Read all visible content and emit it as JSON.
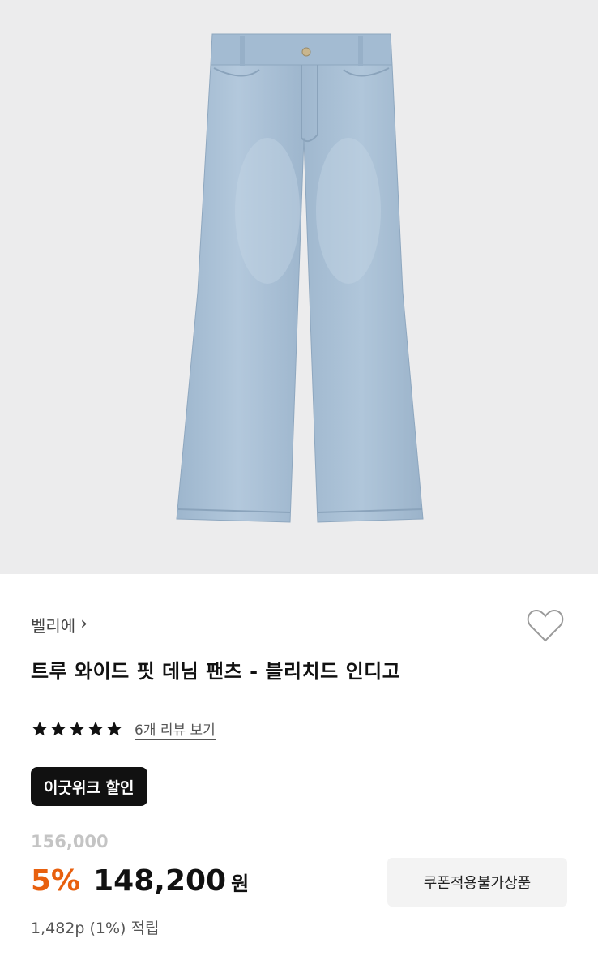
{
  "product": {
    "image_alt": "light blue wide denim pants",
    "brand": "벨리에",
    "title": "트루 와이드 핏 데님 팬츠 - 블리치드 인디고",
    "rating": 5,
    "rating_max": 5,
    "review_link": "6개 리뷰 보기",
    "promo_badge": "이굿위크 할인",
    "original_price": "156,000",
    "discount_rate": "5%",
    "sale_price": "148,200",
    "currency": "원",
    "points": "1,482p (1%) 적립",
    "coupon_label": "쿠폰적용불가상품"
  },
  "icons": {
    "brand_chevron": "chevron-right-icon",
    "wish": "heart-outline-icon",
    "star": "star-icon"
  },
  "colors": {
    "image_background": "#ececed",
    "denim": "#a7bfd6",
    "discount": "#e8600e",
    "badge_background": "#111111",
    "coupon_background": "#f3f3f3"
  }
}
